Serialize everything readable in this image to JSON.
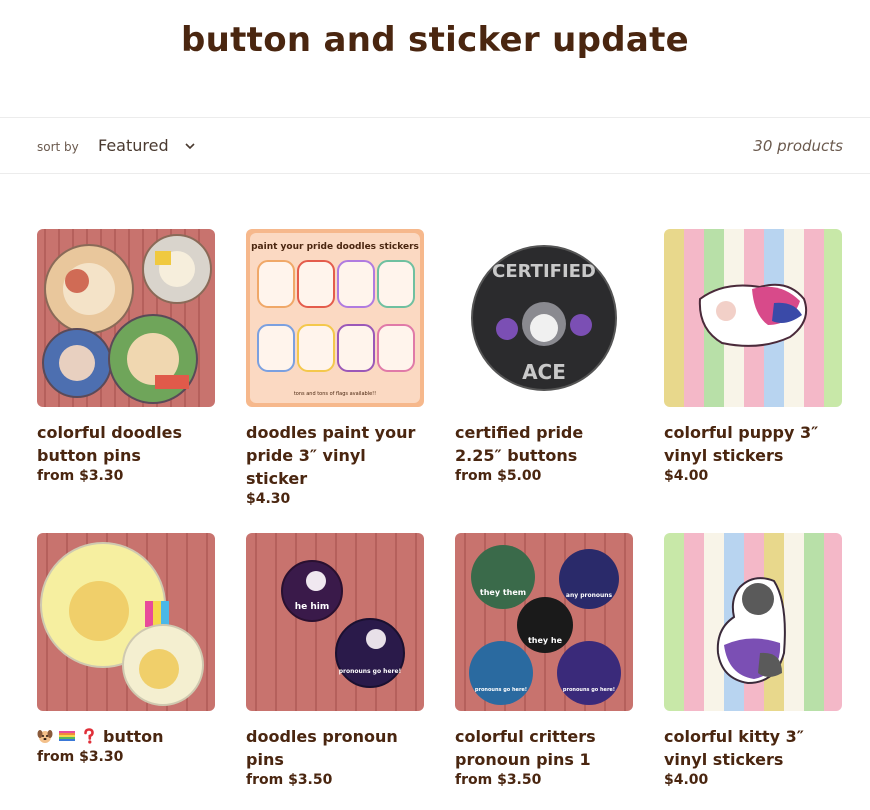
{
  "page": {
    "title": "button and sticker update"
  },
  "toolbar": {
    "sort_label": "sort by",
    "sort_value": "Featured",
    "product_count": "30 products"
  },
  "products": [
    {
      "title": "colorful doodles button pins",
      "price": "from $3.30",
      "image": "corduroy-background-with-four-dog-pins"
    },
    {
      "title": "doodles paint your pride 3″ vinyl sticker",
      "price": "$4.30",
      "image": "sticker-sheet-preview",
      "image_text": {
        "header": "paint your pride doodles stickers",
        "footer": "tons and tons of flags available!!"
      }
    },
    {
      "title": "certified pride 2.25″ buttons",
      "price": "from $5.00",
      "image": "certified-ace-husky-button",
      "image_text": {
        "top": "CERTIFIED",
        "bottom": "ACE"
      }
    },
    {
      "title": "colorful puppy 3″ vinyl stickers",
      "price": "$4.00",
      "image": "puppy-sticker-on-pastel-stripes"
    },
    {
      "title": "button",
      "price": "from $3.30",
      "image": "golden-puppy-buttons",
      "emoji": [
        "dog-face-icon",
        "rainbow-flag-icon",
        "question-mark-icon"
      ]
    },
    {
      "title": "doodles pronoun pins",
      "price": "from $3.50",
      "image": "pronoun-pins-on-corduroy",
      "image_text": {
        "pin1": "he him",
        "pin2": "pronouns go here!"
      }
    },
    {
      "title": "colorful critters pronoun pins 1",
      "price": "from $3.50",
      "image": "critter-pronoun-pins",
      "image_text": {
        "a": "they them",
        "b": "any pronouns",
        "c": "they he",
        "d": "pronouns go here!",
        "e": "pronouns go here!"
      }
    },
    {
      "title": "colorful kitty 3″ vinyl stickers",
      "price": "$4.00",
      "image": "kitty-sticker-on-pastel-stripes"
    }
  ],
  "colors": {
    "heading": "#4a2610",
    "corduroy": "#c8736e",
    "ace_purple": "#7b4fb4"
  }
}
